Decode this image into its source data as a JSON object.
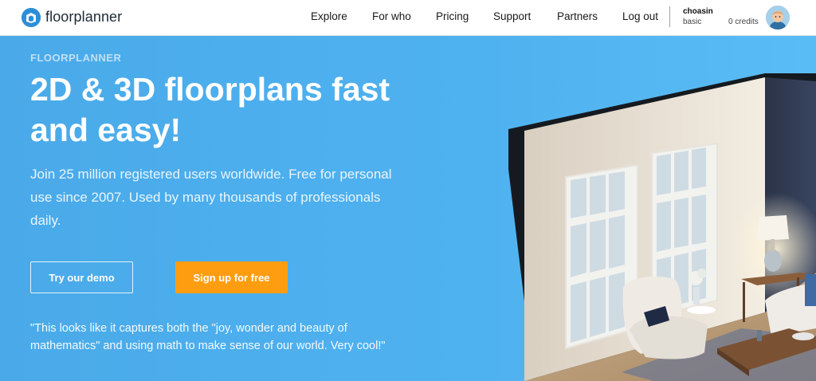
{
  "header": {
    "logo_text": "floorplanner",
    "nav": [
      {
        "label": "Explore"
      },
      {
        "label": "For who"
      },
      {
        "label": "Pricing"
      },
      {
        "label": "Support"
      },
      {
        "label": "Partners"
      },
      {
        "label": "Log out"
      }
    ],
    "user": {
      "name": "choasin",
      "plan": "basic",
      "credits": "0 credits"
    }
  },
  "hero": {
    "eyebrow": "FLOORPLANNER",
    "headline": "2D & 3D floorplans fast and easy!",
    "subtext": "Join 25 million registered users worldwide. Free for personal use since 2007. Used by many thousands of professionals daily.",
    "demo_button": "Try our demo",
    "signup_button": "Sign up for free",
    "quote": "\"This looks like it captures both the \"joy, wonder and beauty of mathematics\" and using math to make sense of our world. Very cool!\""
  },
  "colors": {
    "hero_bg": "#4fb2f0",
    "brand_blue": "#2c8ed9",
    "signup_orange": "#ff9d11"
  },
  "icons": {
    "logo": "floorplanner-logo-icon",
    "avatar": "user-avatar"
  }
}
